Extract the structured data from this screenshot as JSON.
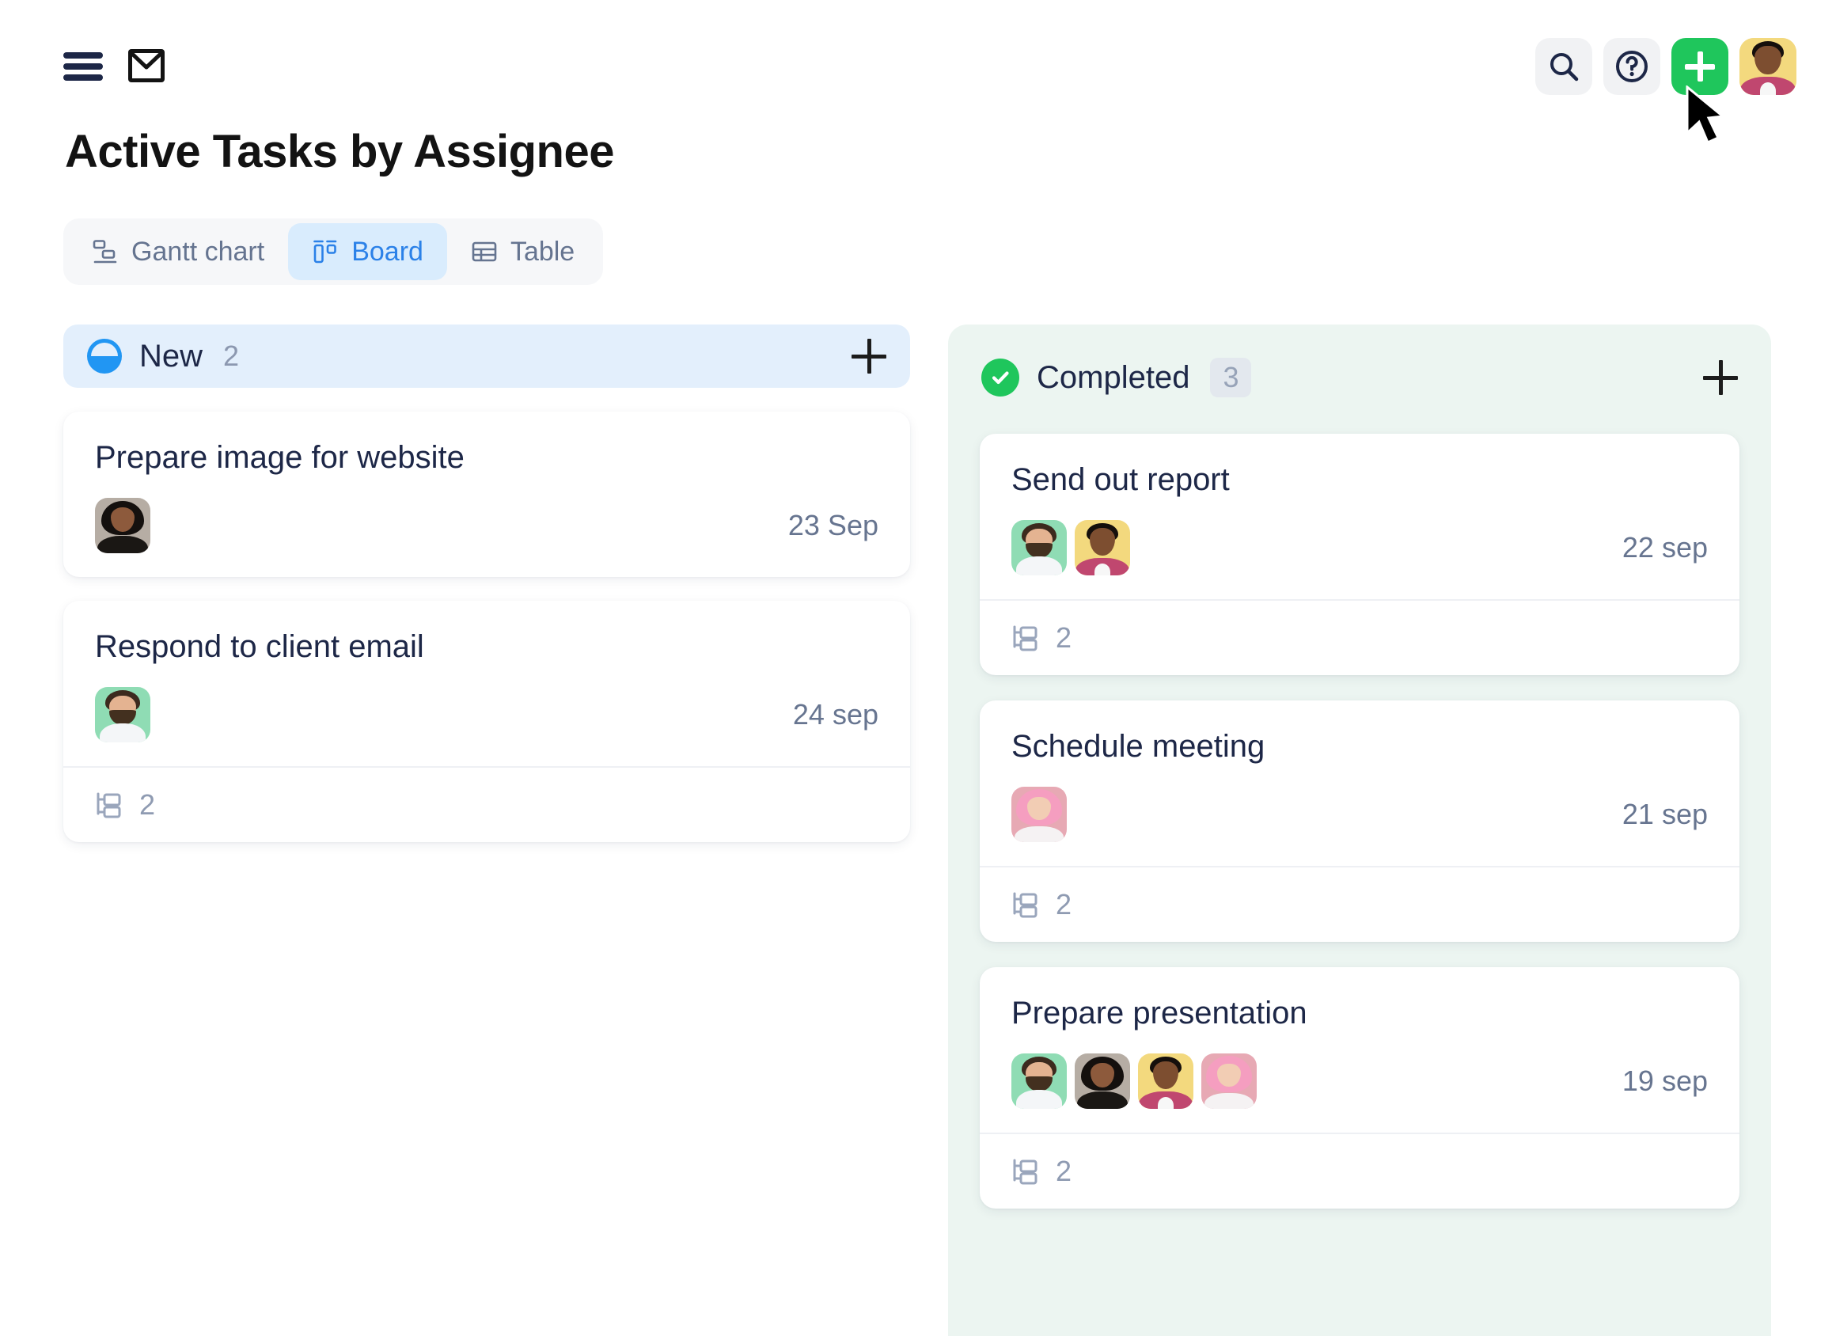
{
  "header": {
    "menu_icon": "hamburger-menu-icon",
    "mail_icon": "mail-icon",
    "search_icon": "search-icon",
    "help_icon": "help-question-icon",
    "add_icon": "plus-icon",
    "avatar_icon": "user-avatar"
  },
  "page_title": "Active Tasks by Assignee",
  "tabs": [
    {
      "label": "Gantt chart",
      "icon": "gantt-chart-icon",
      "active": false
    },
    {
      "label": "Board",
      "icon": "board-kanban-icon",
      "active": true
    },
    {
      "label": "Table",
      "icon": "table-grid-icon",
      "active": false
    }
  ],
  "colors": {
    "accent_blue": "#2b81e8",
    "tab_active_bg": "#d9ecfd",
    "new_header_bg": "#e3effc",
    "new_status": "#2196f3",
    "done_column_bg": "#ecf5f1",
    "done_status": "#1fc65c",
    "add_button": "#1fc65c",
    "muted_text": "#677590"
  },
  "columns": [
    {
      "name": "New",
      "count": "2",
      "status_icon": "half-filled-circle-icon",
      "add_icon": "plus-icon",
      "count_boxed": false,
      "cards": [
        {
          "title": "Prepare image for website",
          "date": "23 Sep",
          "assignees": [
            "woman-dark-avatar"
          ],
          "subtasks": null,
          "subtask_icon": "subtask-hierarchy-icon"
        },
        {
          "title": "Respond to client email",
          "date": "24 sep",
          "assignees": [
            "man-beard-avatar"
          ],
          "subtasks": "2",
          "subtask_icon": "subtask-hierarchy-icon"
        }
      ]
    },
    {
      "name": "Completed",
      "count": "3",
      "status_icon": "check-circle-icon",
      "add_icon": "plus-icon",
      "count_boxed": true,
      "cards": [
        {
          "title": "Send out report",
          "date": "22 sep",
          "assignees": [
            "man-beard-avatar",
            "man-yellow-avatar"
          ],
          "subtasks": "2",
          "subtask_icon": "subtask-hierarchy-icon"
        },
        {
          "title": "Schedule meeting",
          "date": "21 sep",
          "assignees": [
            "woman-pink-avatar"
          ],
          "subtasks": "2",
          "subtask_icon": "subtask-hierarchy-icon"
        },
        {
          "title": "Prepare presentation",
          "date": "19 sep",
          "assignees": [
            "man-beard-avatar",
            "woman-dark-avatar",
            "man-yellow-avatar",
            "woman-pink-avatar"
          ],
          "subtasks": "2",
          "subtask_icon": "subtask-hierarchy-icon"
        }
      ]
    }
  ],
  "cursor": {
    "icon": "mouse-pointer-cursor"
  }
}
